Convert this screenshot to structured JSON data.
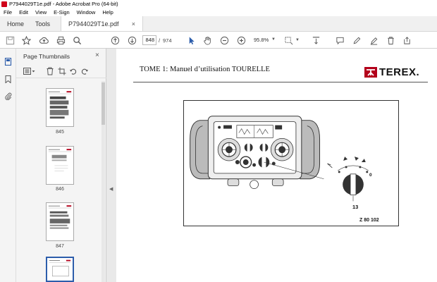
{
  "window": {
    "title": "P7944029T1e.pdf - Adobe Acrobat Pro (64-bit)"
  },
  "menu": [
    "File",
    "Edit",
    "View",
    "E-Sign",
    "Window",
    "Help"
  ],
  "tabs": {
    "home": "Home",
    "tools": "Tools",
    "document": "P7944029T1e.pdf",
    "close": "×"
  },
  "toolbar": {
    "current_page": "848",
    "separator": "/",
    "total_pages": "974",
    "zoom": "95.8%",
    "icons": [
      "save-icon",
      "bookmark-star-icon",
      "upload-icon",
      "print-icon",
      "find-icon",
      "page-up-icon",
      "page-down-icon",
      "select-arrow-icon",
      "hand-icon",
      "zoom-out-icon",
      "zoom-in-icon",
      "marquee-icon",
      "scroll-mode-icon",
      "comment-icon",
      "pen-icon",
      "highlight-icon",
      "delete-icon",
      "share-icon"
    ]
  },
  "thumbnails_panel": {
    "title": "Page Thumbnails",
    "close": "×",
    "pages": [
      {
        "label": "845"
      },
      {
        "label": "846"
      },
      {
        "label": "847"
      },
      {
        "label": ""
      }
    ]
  },
  "document": {
    "header": "TOME 1: Manuel d’utilisation TOURELLE",
    "logo_text": "TEREX.",
    "figure_ref": "Z 80 102",
    "callout_number": "13",
    "switch_zero": "0"
  },
  "colors": {
    "accent": "#2c5dab",
    "brand_red": "#b3001b",
    "app_red": "#d0021b"
  }
}
